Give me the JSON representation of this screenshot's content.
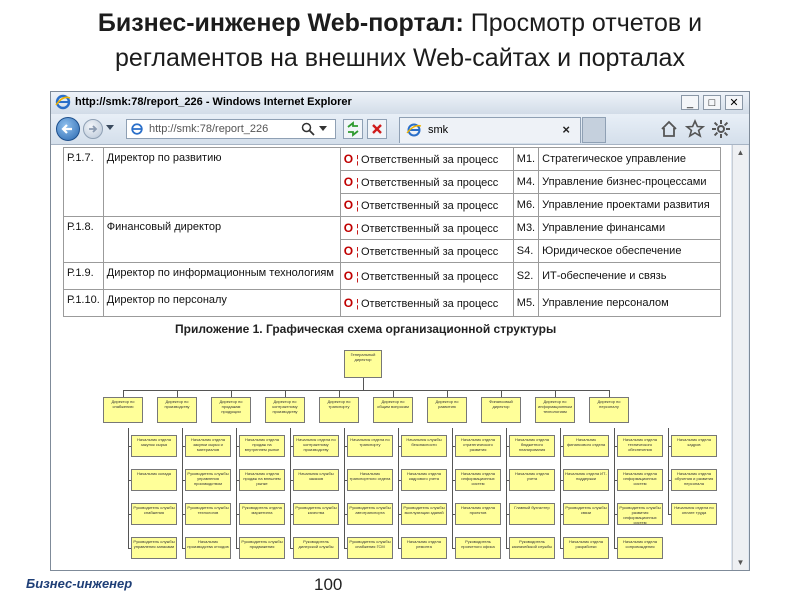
{
  "slide": {
    "title_bold": "Бизнес-инженер Web-портал:",
    "title_rest_line1": " Просмотр отчетов и",
    "title_line2": "регламентов на внешних Web-сайтах и порталах",
    "footer_brand": "Бизнес-инженер",
    "page_number": "100"
  },
  "window": {
    "title": "http://smk:78/report_226 - Windows Internet Explorer",
    "address": "http://smk:78/report_226",
    "tab_label": "smk",
    "tab_close": "×",
    "minimize": "_",
    "maximize": "□",
    "close": "✕"
  },
  "roles_table": {
    "rows": [
      {
        "code": "Р.1.7.",
        "position": "Директор по развитию",
        "o": "O",
        "responsibility": "Ответственный за процесс",
        "process_code": "М1.",
        "process": "Стратегическое управление"
      },
      {
        "code": "",
        "position": "",
        "o": "O",
        "responsibility": "Ответственный за процесс",
        "process_code": "М4.",
        "process": "Управление бизнес-процессами"
      },
      {
        "code": "",
        "position": "",
        "o": "O",
        "responsibility": "Ответственный за процесс",
        "process_code": "М6.",
        "process": "Управление проектами развития"
      },
      {
        "code": "Р.1.8.",
        "position": "Финансовый директор",
        "o": "O",
        "responsibility": "Ответственный за процесс",
        "process_code": "М3.",
        "process": "Управление финансами"
      },
      {
        "code": "",
        "position": "",
        "o": "O",
        "responsibility": "Ответственный за процесс",
        "process_code": "S4.",
        "process": "Юридическое обеспечение"
      },
      {
        "code": "Р.1.9.",
        "position": "Директор по информационным технологиям",
        "o": "O",
        "responsibility": "Ответственный за процесс",
        "process_code": "S2.",
        "process": "ИТ-обеспечение и связь"
      },
      {
        "code": "Р.1.10.",
        "position": "Директор по персоналу",
        "o": "O",
        "responsibility": "Ответственный за процесс",
        "process_code": "М5.",
        "process": "Управление персоналом"
      }
    ]
  },
  "appendix": {
    "title": "Приложение 1. Графическая схема организационной структуры",
    "root": "Генеральный директор",
    "directors": [
      "Директор по снабжению",
      "Директор по производству",
      "Директор по продажам продукции",
      "Директор по контрактному производству",
      "Директор по транспорту",
      "Директор по общим вопросам",
      "Директор по развитию",
      "Финансовый директор",
      "Директор по информационным технологиям",
      "Директор по персоналу"
    ],
    "columns": [
      [
        "Начальник отдела закупок сырья",
        "Начальник склада",
        "Руководитель службы снабжения",
        "Руководитель службы управления запасами"
      ],
      [
        "Начальник отдела закупки сырья и материалов",
        "Руководитель службы управления производством",
        "Руководитель службы технологов",
        "Начальник производства отходов"
      ],
      [
        "Начальник отдела продаж на внутреннем рынке",
        "Начальник отдела продаж на внешнем рынке",
        "Руководитель отдела маркетинга",
        "Руководитель службы продвижения"
      ],
      [
        "Начальник отдела по контрактному производству",
        "Начальник службы заказов",
        "Руководитель службы качества",
        "Руководитель дилерской службы"
      ],
      [
        "Начальник отдела по транспорту",
        "Начальник транспортного отдела",
        "Руководитель службы автотранспорта",
        "Руководитель службы снабжения ГСМ"
      ],
      [
        "Начальник службы безопасности",
        "Начальник отдела кадрового учета",
        "Руководитель службы эксплуатации зданий",
        "Начальник отдела ремонта"
      ],
      [
        "Начальник отдела стратегического развития",
        "Начальник отдела информационных систем",
        "Начальник отдела проектов",
        "Руководитель проектного офиса"
      ],
      [
        "Начальник отдела бюджетного планирования",
        "Начальник отдела учета",
        "Главный бухгалтер",
        "Руководитель казначейской службы"
      ],
      [
        "Начальник финансового отдела",
        "Начальник отдела ИТ-поддержки",
        "Руководитель службы связи",
        "Начальник отдела разработки"
      ],
      [
        "Начальник отдела технического обеспечения",
        "Начальник отдела информационных систем",
        "Руководитель службы развития информационных систем",
        "Начальник отдела сопровождения"
      ],
      [
        "Начальник отдела кадров",
        "Начальник отдела обучения и развития персонала",
        "Начальник отдела по оплате труда"
      ]
    ]
  },
  "icons": {
    "ie": "ie-logo-icon",
    "back": "back-arrow-icon",
    "forward": "forward-arrow-icon",
    "search": "search-icon",
    "refresh": "refresh-icon",
    "stop": "stop-icon",
    "home": "home-icon",
    "favorites": "star-icon",
    "tools": "gear-icon"
  },
  "colors": {
    "accent_red": "#c00000",
    "box_fill": "#ffff99",
    "footer_brand": "#1f3f77"
  }
}
